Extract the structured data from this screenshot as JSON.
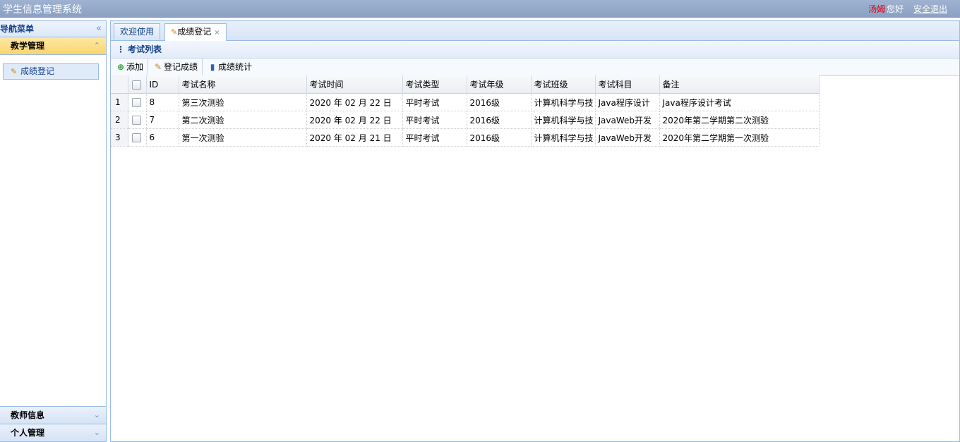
{
  "header": {
    "title": "学生信息管理系统",
    "user_name": "汤姆",
    "greeting": "您好",
    "logout": "安全退出"
  },
  "nav": {
    "title": "导航菜单",
    "collapse_glyph": "«",
    "sections": [
      {
        "label": "教学管理",
        "state": "expanded",
        "items": [
          {
            "label": "成绩登记",
            "icon": "edit-icon"
          }
        ]
      },
      {
        "label": "教师信息",
        "state": "collapsed"
      },
      {
        "label": "个人管理",
        "state": "collapsed"
      }
    ]
  },
  "tabs": [
    {
      "label": "欢迎使用",
      "active": false
    },
    {
      "label": "成绩登记",
      "active": true,
      "closable": true,
      "icon": "edit-icon"
    }
  ],
  "panel": {
    "title": "考试列表"
  },
  "toolbar": {
    "add": "添加",
    "register": "登记成绩",
    "stats": "成绩统计"
  },
  "grid": {
    "columns": [
      "ID",
      "考试名称",
      "考试时间",
      "考试类型",
      "考试年级",
      "考试班级",
      "考试科目",
      "备注"
    ],
    "rows": [
      {
        "num": "1",
        "id": "8",
        "name": "第三次测验",
        "time": "2020 年 02 月 22 日",
        "type": "平时考试",
        "grade": "2016级",
        "class": "计算机科学与技",
        "subject": "Java程序设计",
        "remark": "Java程序设计考试"
      },
      {
        "num": "2",
        "id": "7",
        "name": "第二次测验",
        "time": "2020 年 02 月 22 日",
        "type": "平时考试",
        "grade": "2016级",
        "class": "计算机科学与技",
        "subject": "JavaWeb开发",
        "remark": "2020年第二学期第二次测验"
      },
      {
        "num": "3",
        "id": "6",
        "name": "第一次测验",
        "time": "2020 年 02 月 21 日",
        "type": "平时考试",
        "grade": "2016级",
        "class": "计算机科学与技",
        "subject": "JavaWeb开发",
        "remark": "2020年第二学期第一次测验"
      }
    ]
  },
  "colors": {
    "header_bg": "#8ba0c2",
    "accent_border": "#99bbe8",
    "active_section": "#f9d56b",
    "user_name": "#e00000"
  }
}
